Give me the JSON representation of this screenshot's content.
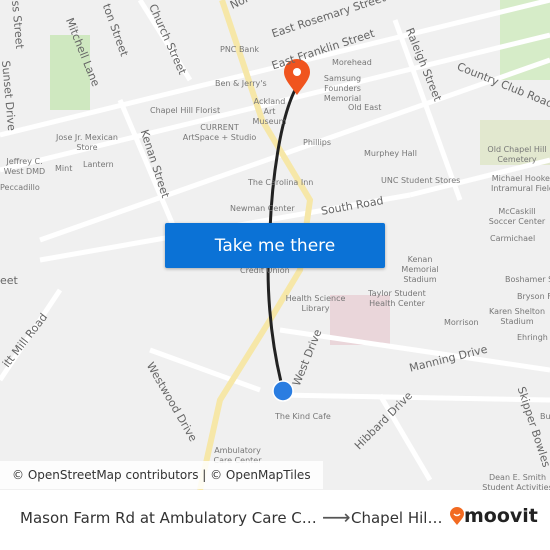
{
  "map": {
    "streets": [
      "North",
      "East Rosemary Street",
      "East Franklin Street",
      "Church Street",
      "Mitchell Lane",
      "Sunset Drive",
      "ton Street",
      "ss Street",
      "Kenan Street",
      "Raleigh Street",
      "Country Club Road",
      "South Road",
      "Manning Drive",
      "West Drive",
      "Westwood Drive",
      "Hibbard Drive",
      "Skipper Bowles",
      "itt Mill Road",
      "eet"
    ],
    "places": [
      "PNC Bank",
      "Ben & Jerry's",
      "Ackland Art Museum",
      "Chapel Hill Florist",
      "CURRENT ArtSpace + Studio",
      "Jose Jr. Mexican Store",
      "Jeffrey C. West DMD",
      "Mint",
      "Lantern",
      "Peccadillo",
      "The Carolina Inn",
      "Newman Center",
      "Morehead",
      "Samsung Founders Memorial",
      "Old East",
      "Phillips",
      "Murphey Hall",
      "UNC Student Stores",
      "Old Chapel Hill Cemetery",
      "Michael Hooker Intramural Field",
      "McCaskill Soccer Center",
      "Carmichael",
      "Kenan Memorial Stadium",
      "Credit Union",
      "Health Science Library",
      "Taylor Student Health Center",
      "Morrison",
      "Karen Shelton Stadium",
      "Boshamer S",
      "Bryson F",
      "Ehringh",
      "The Kind Cafe",
      "Ambulatory Care Center",
      "Dean E. Smith Student Activities Center",
      "Bu"
    ],
    "origin_marker_color": "#2a7de1",
    "destination_marker_color": "#f0541e",
    "route_color": "#222222",
    "attribution": "© OpenStreetMap contributors | © OpenMapTiles"
  },
  "cta": {
    "label": "Take me there",
    "color": "#0b72d6"
  },
  "footer": {
    "from": "Mason Farm Rd at Ambulatory Care C…",
    "arrow_icon": "arrow-right-icon",
    "to": "Chapel Hil…",
    "brand": "moovit",
    "brand_color": "#f26a21"
  }
}
